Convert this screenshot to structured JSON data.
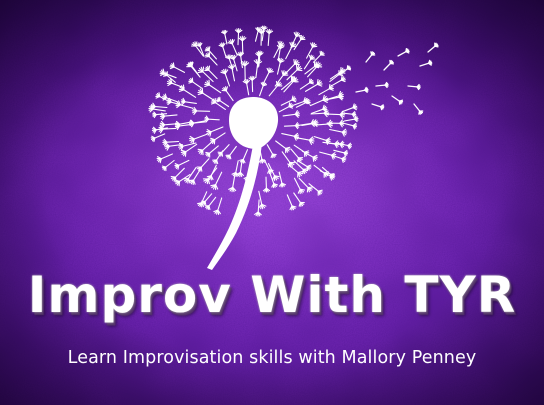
{
  "title": "Improv With TYR",
  "subtitle": "Learn Improvisation skills with Mallory Penney",
  "colors": {
    "background": "#6a22ad",
    "text": "#ffffff"
  },
  "graphics": {
    "emblem": "dandelion-icon"
  }
}
